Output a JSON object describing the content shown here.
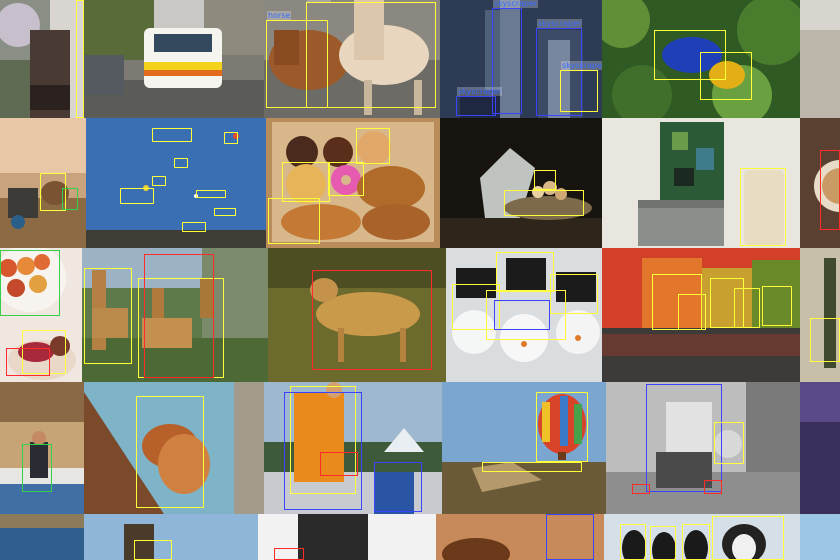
{
  "colors": {
    "box_yellow": "#ffff3a",
    "box_blue": "#3b45ff",
    "box_red": "#ff2b2b",
    "box_green": "#35d14a"
  },
  "tiles": {
    "balcony_building": {
      "subject": "balcony building"
    },
    "ambulance_street": {
      "subject": "ambulance on street"
    },
    "horses": {
      "subject": "two horses",
      "labels": [
        "horse",
        "horse"
      ]
    },
    "skyscrapers": {
      "subject": "skyscrapers",
      "labels": [
        "skyscraper",
        "skyscraper",
        "skyscraper",
        "skyscraper"
      ]
    },
    "frogs_leaves": {
      "subject": "frogs on leaves"
    },
    "edge_top_right": {
      "subject": "partial image"
    },
    "camels_desert": {
      "subject": "camels in desert"
    },
    "kites_sky": {
      "subject": "kites in sky"
    },
    "donuts_box": {
      "subject": "donuts in box"
    },
    "eggs_bowl": {
      "subject": "eggs in bowl"
    },
    "painting_box_vase": {
      "subject": "painting, box and vase"
    },
    "coffee_edge": {
      "subject": "coffee cup"
    },
    "fruit_bowl": {
      "subject": "fruit bowl"
    },
    "giraffes": {
      "subject": "giraffes"
    },
    "cheetah": {
      "subject": "cheetah"
    },
    "snowman_cakepops": {
      "subject": "snowman cake pops"
    },
    "autumn_lake": {
      "subject": "autumn lake"
    },
    "edge_tree": {
      "subject": "tree"
    },
    "photographer_river": {
      "subject": "photographer by river"
    },
    "squirrel_tree": {
      "subject": "squirrel on tree"
    },
    "hikers_mountains": {
      "subject": "hikers at mountains"
    },
    "hot_air_balloon": {
      "subject": "hot air balloon"
    },
    "man_bw": {
      "subject": "man with ball"
    },
    "edge_purple": {
      "subject": "partial image"
    },
    "bottom_1": {
      "subject": "partial image"
    },
    "bottom_2": {
      "subject": "partial image"
    },
    "bottom_3": {
      "subject": "partial image"
    },
    "bottom_4": {
      "subject": "partial image"
    },
    "penguins": {
      "subject": "penguins"
    },
    "bottom_6": {
      "subject": "partial image"
    }
  }
}
